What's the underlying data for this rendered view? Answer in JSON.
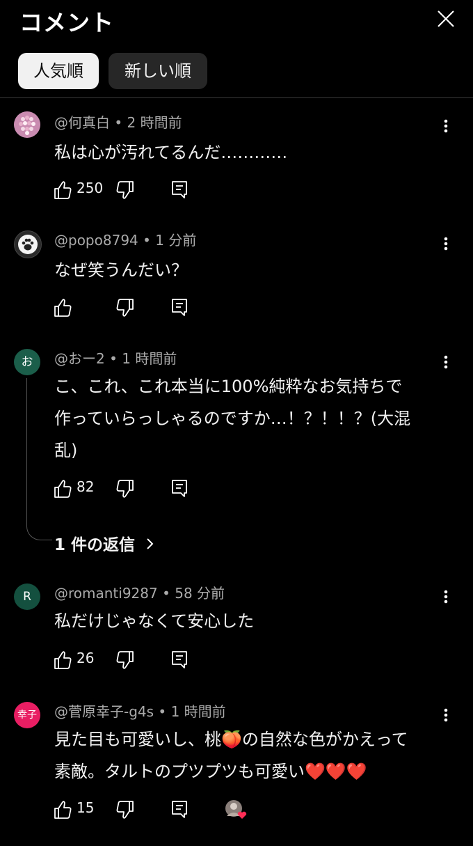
{
  "header": {
    "title": "コメント"
  },
  "chips": [
    {
      "label": "人気順"
    },
    {
      "label": "新しい順"
    }
  ],
  "comments": [
    {
      "author": "@何真白",
      "time": "2 時間前",
      "text": "私は心が汚れてるんだ…………",
      "likes": "250",
      "avatar_color": "#b07ca0"
    },
    {
      "author": "@popo8794",
      "time": "1 分前",
      "text": "なぜ笑うんだい？",
      "likes": "",
      "avatar_color": "#2a2a2a"
    },
    {
      "author": "@おー2",
      "time": "1 時間前",
      "text_lines": [
        "こ、これ、これ本当に100%純粋なお気持ちで",
        "作っていらっしゃるのですか…！？！！？(大混",
        "乱)"
      ],
      "likes": "82",
      "avatar_initial": "お",
      "avatar_color": "#1b5e4a",
      "replies": "1 件の返信"
    },
    {
      "author": "@romanti9287",
      "time": "58 分前",
      "text": "私だけじゃなくて安心した",
      "likes": "26",
      "avatar_initial": "R",
      "avatar_color": "#14503f"
    },
    {
      "author": "@菅原幸子-g4s",
      "time": "1 時間前",
      "text_lines": [
        "見た目も可愛いし、桃🍑の自然な色がかえって",
        "素敵。タルトのプツプツも可愛い❤️❤️❤️"
      ],
      "likes": "15",
      "avatar_initial": "幸子",
      "avatar_color": "#e91e63"
    }
  ],
  "meta_sep": " • "
}
